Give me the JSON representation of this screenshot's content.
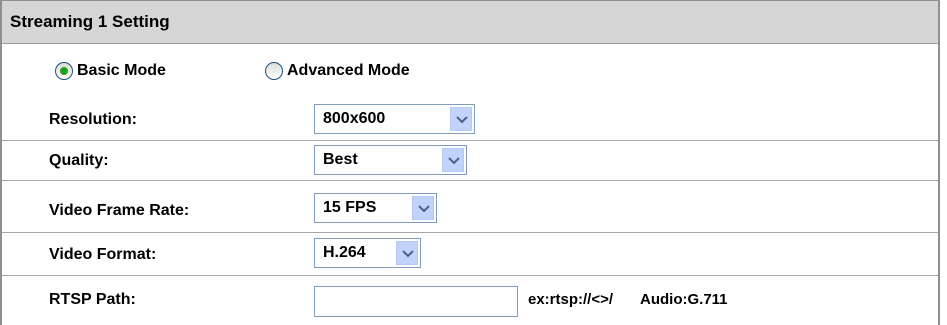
{
  "panel": {
    "title": "Streaming 1 Setting"
  },
  "mode": {
    "basic_label": "Basic Mode",
    "advanced_label": "Advanced Mode",
    "selected": "basic"
  },
  "fields": {
    "resolution": {
      "label": "Resolution:",
      "value": "800x600"
    },
    "quality": {
      "label": "Quality:",
      "value": "Best"
    },
    "frame_rate": {
      "label": "Video Frame Rate:",
      "value": "15 FPS"
    },
    "video_format": {
      "label": "Video Format:",
      "value": "H.264"
    },
    "rtsp_path": {
      "label": "RTSP Path:",
      "value": "",
      "hint": "ex:rtsp://<>/",
      "audio": "Audio:G.711"
    }
  },
  "colors": {
    "header_bg": "#d6d6d6",
    "border": "#8f8f8f",
    "select_arrow_bg": "#c1d3fb",
    "radio_dot": "#21a121"
  }
}
